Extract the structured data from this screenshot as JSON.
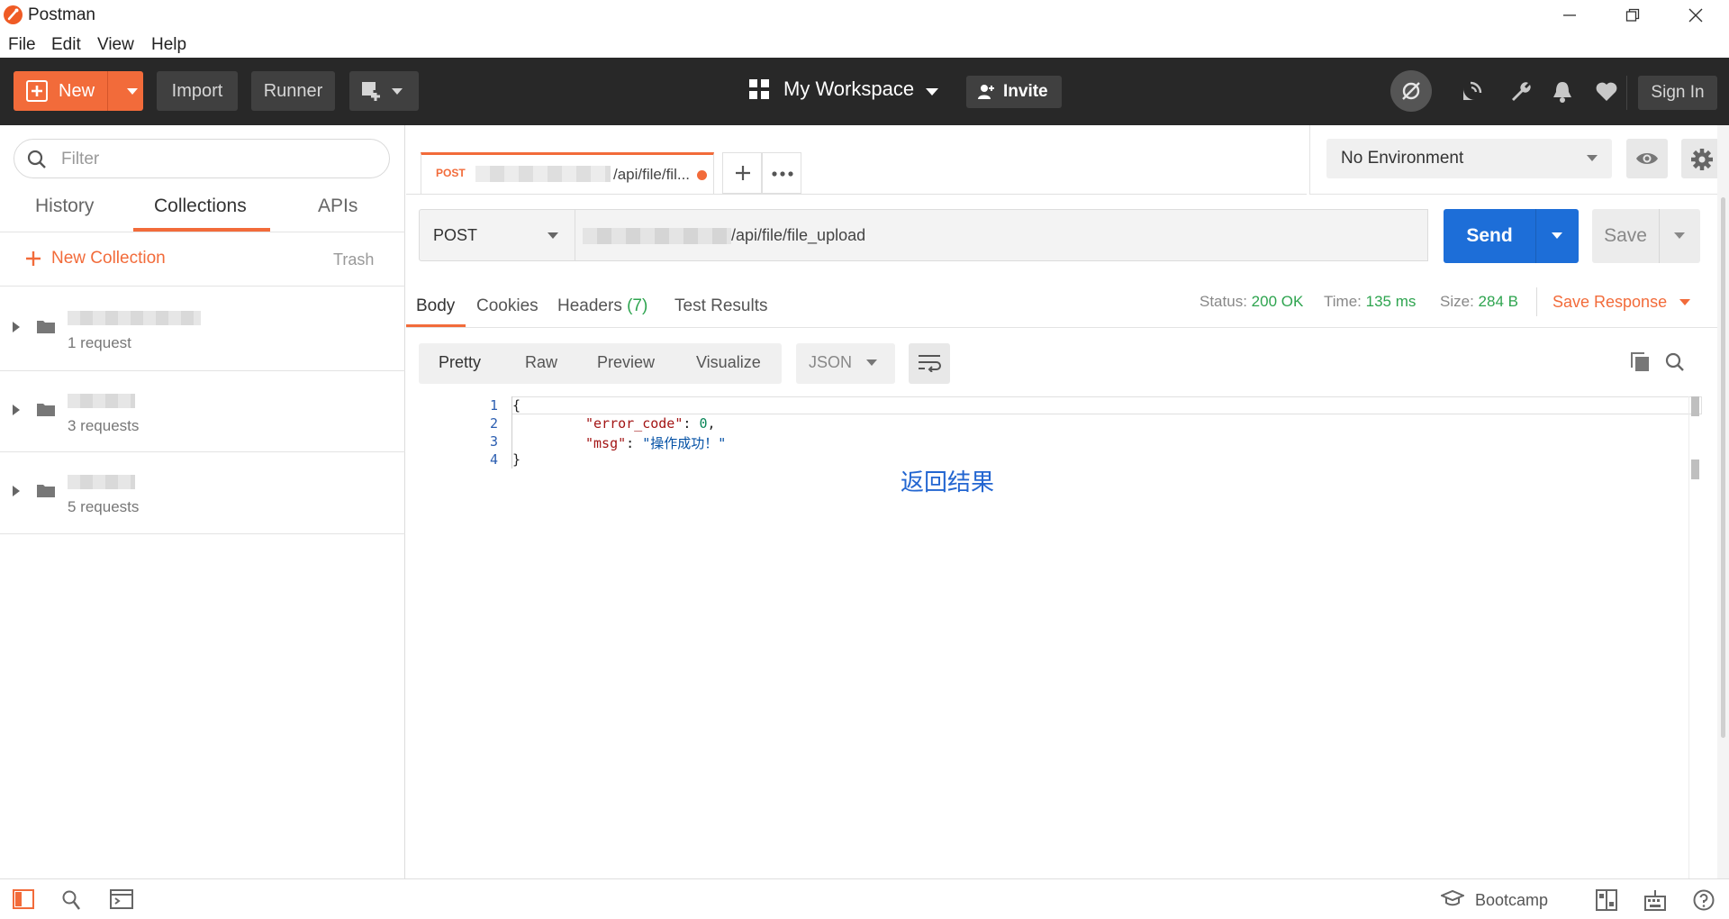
{
  "app": {
    "title": "Postman",
    "accent": "#f26b3a",
    "send_color": "#1d6ed8"
  },
  "menu": [
    "File",
    "Edit",
    "View",
    "Help"
  ],
  "header": {
    "new_label": "New",
    "import_label": "Import",
    "runner_label": "Runner",
    "workspace_label": "My Workspace",
    "invite_label": "Invite",
    "signin_label": "Sign In"
  },
  "sidebar": {
    "filter_placeholder": "Filter",
    "tabs": [
      "History",
      "Collections",
      "APIs"
    ],
    "new_collection_label": "New Collection",
    "trash_label": "Trash",
    "collections": [
      {
        "count": "1 request"
      },
      {
        "count": "3 requests"
      },
      {
        "count": "5 requests"
      }
    ]
  },
  "request_tab": {
    "method": "POST",
    "url_tail": "/api/file/fil..."
  },
  "environment": {
    "selected": "No Environment"
  },
  "request": {
    "method": "POST",
    "url_tail": "/api/file/file_upload",
    "send_label": "Send",
    "save_label": "Save"
  },
  "response": {
    "tabs": {
      "body": "Body",
      "cookies": "Cookies",
      "headers": "Headers",
      "headers_count": "(7)",
      "test_results": "Test Results"
    },
    "status_label": "Status:",
    "status_value": "200 OK",
    "time_label": "Time:",
    "time_value": "135 ms",
    "size_label": "Size:",
    "size_value": "284 B",
    "save_response_label": "Save Response",
    "view_modes": [
      "Pretty",
      "Raw",
      "Preview",
      "Visualize"
    ],
    "format": "JSON",
    "lines": [
      "1",
      "2",
      "3",
      "4"
    ],
    "body": {
      "key1": "\"error_code\"",
      "val1": "0",
      "key2": "\"msg\"",
      "val2": "\"操作成功！\""
    },
    "annotation": "返回结果"
  },
  "footer": {
    "bootcamp_label": "Bootcamp"
  }
}
